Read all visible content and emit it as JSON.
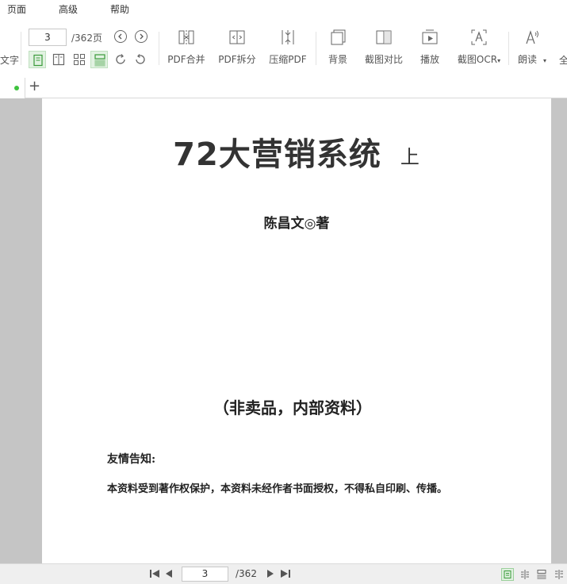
{
  "menubar": {
    "items": [
      "页面",
      "高级",
      "帮助"
    ]
  },
  "toolbar": {
    "left_cut_label": "文字",
    "page_input_value": "3",
    "total_pages": "/362页",
    "buttons": [
      {
        "label": "PDF合并",
        "icon": "pdf-merge-icon"
      },
      {
        "label": "PDF拆分",
        "icon": "pdf-split-icon"
      },
      {
        "label": "压缩PDF",
        "icon": "compress-pdf-icon"
      },
      {
        "label": "背景",
        "icon": "background-icon"
      },
      {
        "label": "截图对比",
        "icon": "screenshot-compare-icon"
      },
      {
        "label": "播放",
        "icon": "play-icon"
      },
      {
        "label": "截图OCR",
        "icon": "screenshot-ocr-icon"
      },
      {
        "label": "朗读",
        "icon": "read-aloud-icon"
      }
    ],
    "right_cut_label": "全"
  },
  "document": {
    "title": "72大营销系统",
    "title_volume": "上",
    "author": "陈昌文◎著",
    "notice": "（非卖品，内部资料）",
    "friendly_heading": "友情告知:",
    "friendly_body": "本资料受到著作权保护，本资料未经作者书面授权，不得私自印刷、传播。"
  },
  "statusbar": {
    "page_value": "3",
    "total": "/362"
  },
  "colors": {
    "accent": "#3ec33e",
    "doc_background": "#c5c5c5"
  }
}
